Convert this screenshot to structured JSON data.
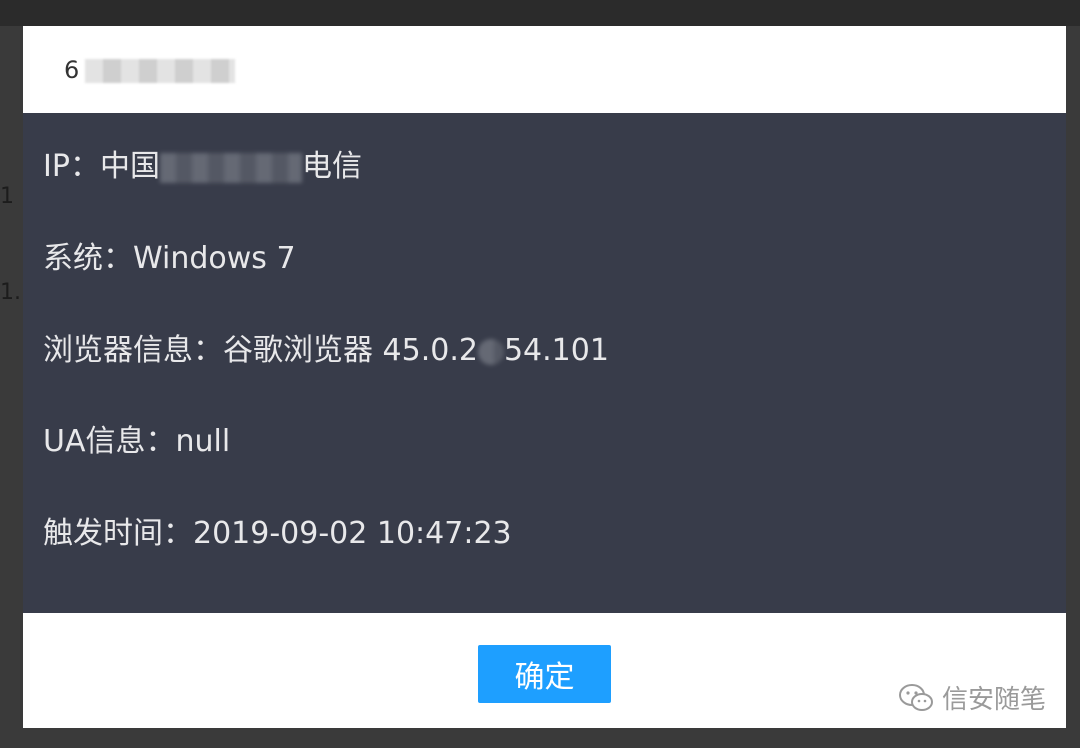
{
  "dialog": {
    "title_prefix": "6"
  },
  "info": {
    "ip": {
      "label": "IP：",
      "value_start": "中国",
      "value_end": "电信"
    },
    "os": {
      "label": "系统：",
      "value": "Windows 7"
    },
    "browser": {
      "label": "浏览器信息：",
      "value_start": "谷歌浏览器 45.0.2",
      "value_end": "54.101"
    },
    "ua": {
      "label": "UA信息：",
      "value": "null"
    },
    "time": {
      "label": "触发时间：",
      "value": "2019-09-02 10:47:23"
    }
  },
  "footer": {
    "confirm_label": "确定"
  },
  "watermark": {
    "text": "信安随笔"
  },
  "background": {
    "fragment_1": "1",
    "fragment_2": "1."
  },
  "colors": {
    "body_bg": "#383c4a",
    "accent": "#1e9fff"
  }
}
